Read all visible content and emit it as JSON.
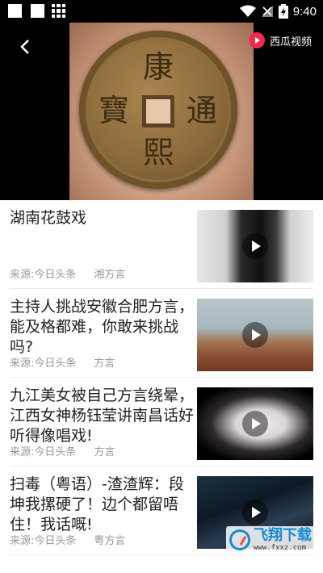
{
  "status_bar": {
    "time": "9:40",
    "icons": [
      "notification-square-icon",
      "notification-square-icon",
      "grid-icon",
      "wifi-icon",
      "no-signal-icon",
      "battery-charging-icon"
    ]
  },
  "video": {
    "coin_characters": [
      "康",
      "熙",
      "通",
      "寶"
    ],
    "brand_label": "西瓜视频",
    "icons": [
      "back-arrow-icon",
      "xigua-logo-icon"
    ]
  },
  "list": {
    "items": [
      {
        "title": "湖南花鼓戏",
        "source": "来源:今日头条",
        "tag": "湘方言",
        "thumb": "t1"
      },
      {
        "title": "主持人挑战安徽合肥方言，能及格都难，你敢来挑战吗?",
        "source": "来源:今日头条",
        "tag": "方言",
        "thumb": "t2"
      },
      {
        "title": "九江美女被自己方言绕晕，江西女神杨钰莹讲南昌话好听得像唱戏!",
        "source": "来源:今日头条",
        "tag": "方言",
        "thumb": "t3"
      },
      {
        "title": "扫毒（粤语）-渣渣辉：段坤我摞硬了！边个都留唔住！我话嘅!",
        "source": "来源:今日头条",
        "tag": "粤方言",
        "thumb": "t4"
      }
    ]
  },
  "watermark": {
    "title": "飞翔下载",
    "url": "www.fxxz.com"
  },
  "colors": {
    "accent_red": "#ee2b4b",
    "watermark_blue": "#1a8ad4"
  }
}
